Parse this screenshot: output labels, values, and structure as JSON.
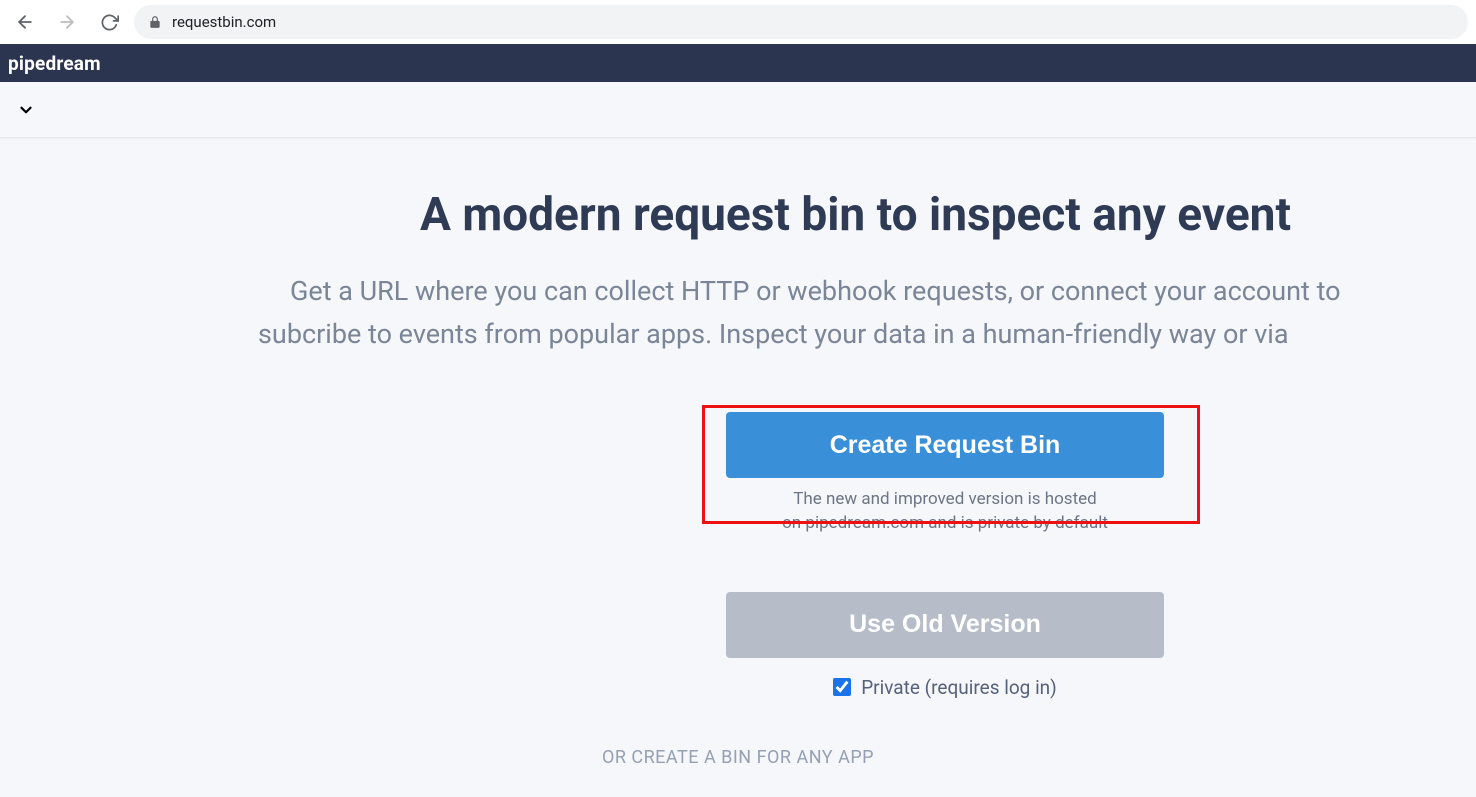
{
  "browser": {
    "url": "requestbin.com"
  },
  "header": {
    "brand": "pipedream"
  },
  "hero": {
    "title": "A modern request bin to inspect any event",
    "subtitle_line1": "Get a URL where you can collect HTTP or webhook requests, or connect your account to",
    "subtitle_line2": "subcribe to events from popular apps. Inspect your data in a human-friendly way or via"
  },
  "cta": {
    "create_label": "Create Request Bin",
    "caption_line1": "The new and improved version is hosted",
    "caption_line2": "on pipedream.com and is private by default",
    "old_label": "Use Old Version",
    "private_label": "Private (requires log in)",
    "private_checked": true
  },
  "divider": {
    "text": "OR CREATE A BIN FOR ANY APP"
  }
}
